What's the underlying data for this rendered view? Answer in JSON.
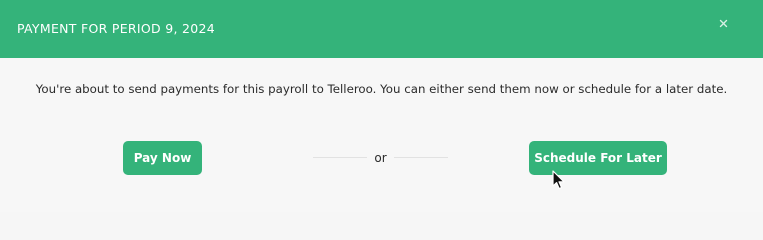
{
  "modal": {
    "title": "PAYMENT FOR PERIOD 9, 2024",
    "close_icon": "×",
    "message": "You're about to send payments for this payroll to Telleroo. You can either send them now or schedule for a later date.",
    "pay_now_label": "Pay Now",
    "separator_label": "or",
    "schedule_label": "Schedule For Later"
  },
  "colors": {
    "accent": "#34b37a",
    "header_text": "#ffffff",
    "body_background": "#f7f7f7",
    "body_text": "#2b2b2b"
  },
  "icons": {
    "close": "close-icon",
    "cursor": "mouse-pointer-icon"
  }
}
